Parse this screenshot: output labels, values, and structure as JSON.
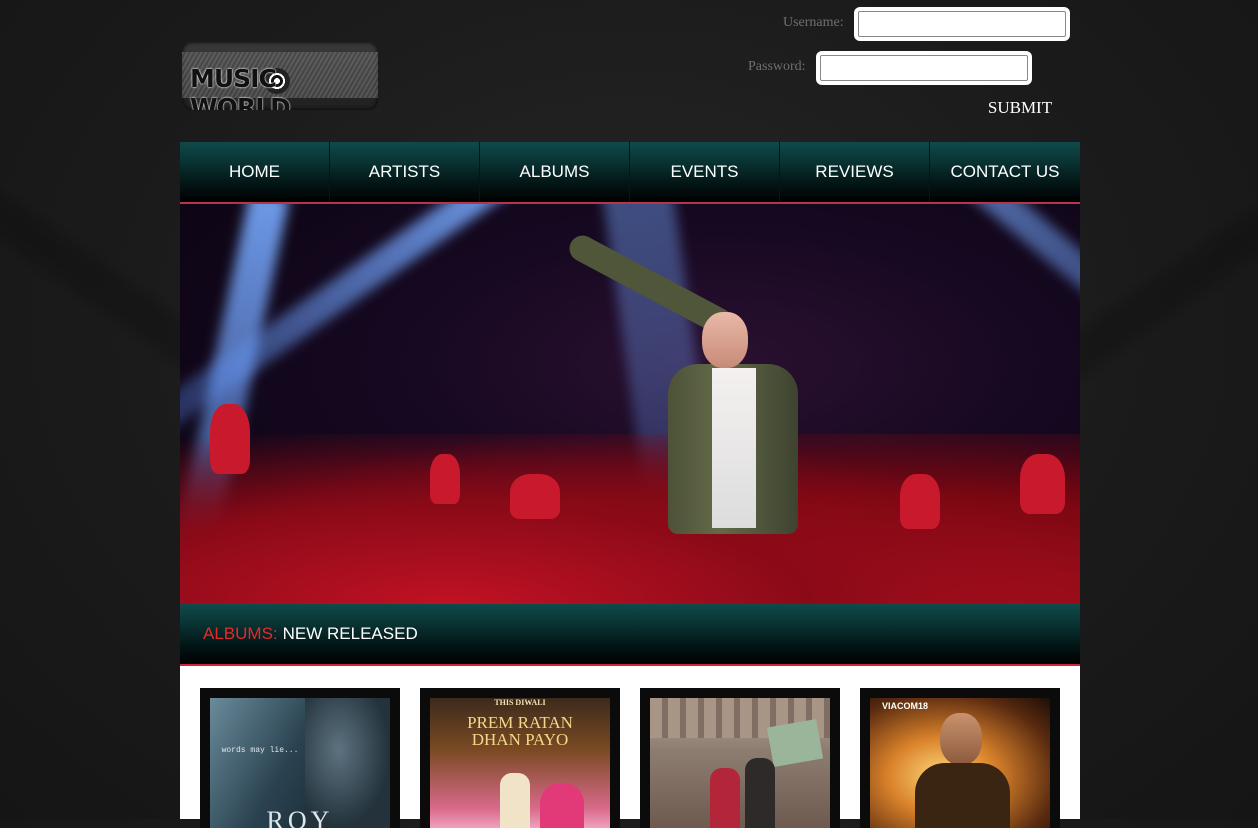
{
  "header": {
    "logo_text": "MUSIC WORLD",
    "username_label": "Username:",
    "password_label": "Password:",
    "username_value": "",
    "password_value": "",
    "submit_label": "SUBMIT"
  },
  "nav": {
    "items": [
      {
        "label": "HOME"
      },
      {
        "label": "ARTISTS"
      },
      {
        "label": "ALBUMS"
      },
      {
        "label": "EVENTS"
      },
      {
        "label": "REVIEWS"
      },
      {
        "label": "CONTACT US"
      }
    ]
  },
  "albums_section": {
    "title_prefix": "ALBUMS:",
    "title_suffix": "NEW RELEASED"
  },
  "albums": [
    {
      "cover_text": "ROY",
      "tagline": "words may lie..."
    },
    {
      "cover_text": "PREM RATAN DHAN PAYO",
      "tagline": "THIS DIWALI"
    },
    {
      "cover_text": "",
      "tagline": ""
    },
    {
      "cover_text": "",
      "tagline": "VIACOM18"
    }
  ],
  "colors": {
    "nav_teal": "#0f4a4a",
    "accent_red": "#e52a2a",
    "rule_red": "#b8344c"
  }
}
